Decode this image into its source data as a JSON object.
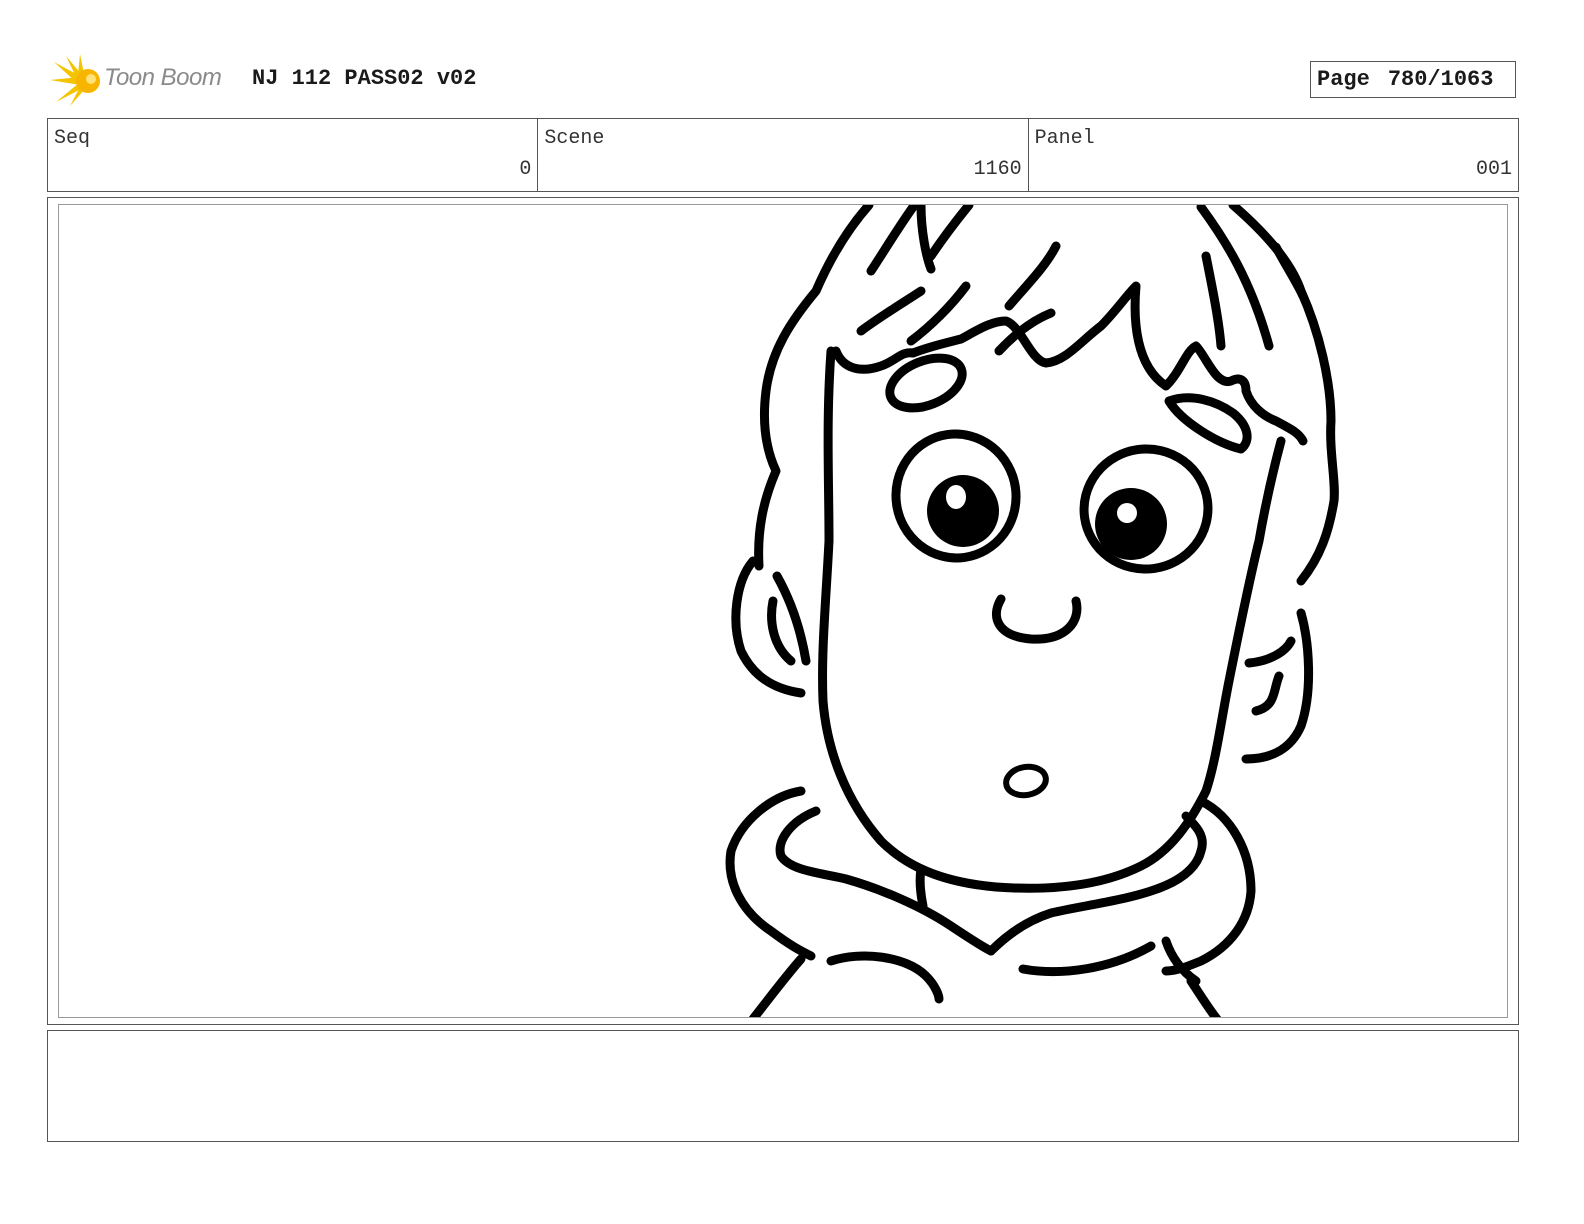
{
  "header": {
    "logo_text": "Toon Boom",
    "title": "NJ 112 PASS02 v02",
    "page_label": "Page",
    "page_number": "780/1063"
  },
  "info": {
    "seq": {
      "label": "Seq",
      "value": "0"
    },
    "scene": {
      "label": "Scene",
      "value": "1160"
    },
    "panel": {
      "label": "Panel",
      "value": "001"
    }
  },
  "notes": {
    "text": ""
  },
  "colors": {
    "logo_accent": "#f5c400",
    "line": "#000000",
    "border": "#555555"
  },
  "icons": {
    "logo": "starburst-logo-icon"
  }
}
